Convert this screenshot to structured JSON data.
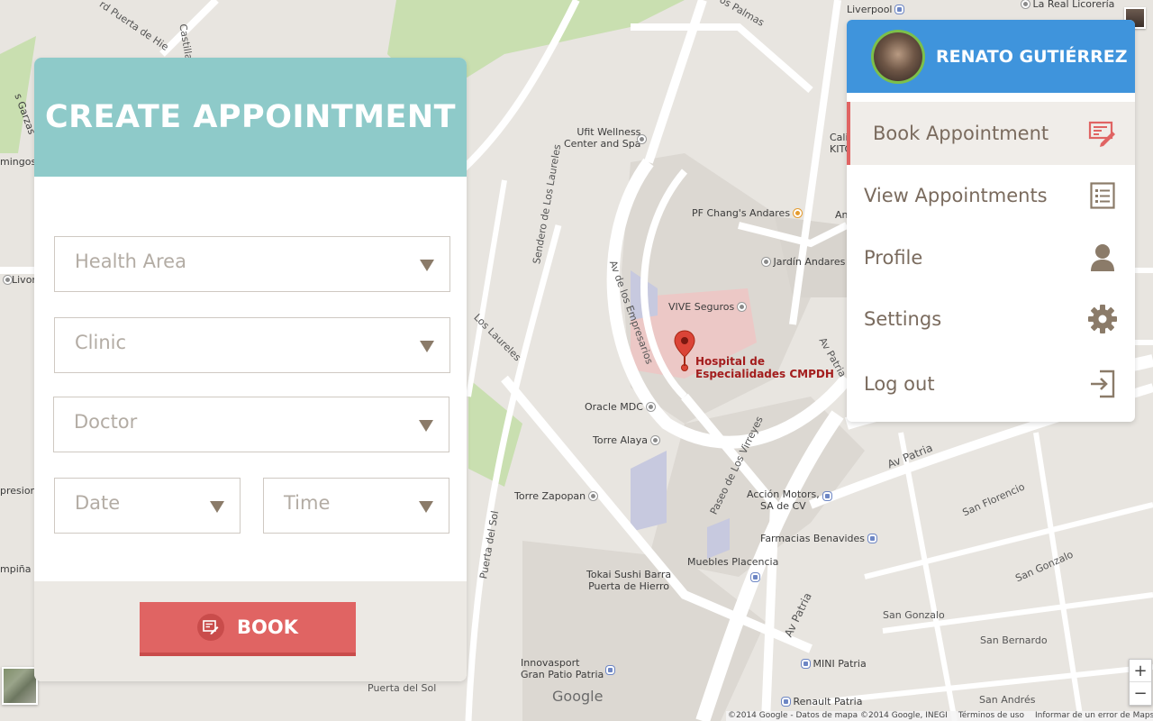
{
  "map": {
    "labels": {
      "liverpool": "Liverpool",
      "la_real_licoreria": "La Real Licorería",
      "ufit": "Ufit Wellness\nCenter and Spa",
      "pf_changs": "PF Chang's Andares",
      "jardin_andares": "Jardín Andares",
      "vive_seguros": "VIVE Seguros",
      "oracle": "Oracle MDC",
      "torre_alaya": "Torre Alaya",
      "torre_zapopan": "Torre Zapopan",
      "accion_motors": "Acción Motors,\nSA de CV",
      "farmacias": "Farmacias Benavides",
      "muebles": "Muebles Placencia",
      "tokai": "Tokai Sushi Barra\nPuerta de Hierro",
      "innovasport": "Innovasport\nGran Patio Patria",
      "mini_patria": "MINI Patria",
      "renault": "Renault Patria",
      "san_florencio": "San Florencio",
      "san_gonzalo": "San Gonzalo",
      "san_bernardo": "San Bernardo",
      "san_andres": "San Andrés",
      "av_patria": "Av Patria",
      "paseo_virreyes": "Paseo de Los Virreyes",
      "av_empresarios": "Av de los Empresarios",
      "sendero_laureles": "Sendero de Los Laureles",
      "los_laureles": "Los Laureles",
      "puerta_sol": "Puerta del Sol",
      "puerta_hierro": "rd Puerta de Hie",
      "castilla": "Castilla",
      "palmas": "os Palmas",
      "livorno": "Livorn",
      "presion": "presion",
      "pina": "mpiña",
      "mingos": "mingos",
      "garzas": "s Garzas",
      "cali": "Cali\nKITC",
      "an": "An",
      "av_patria_right": "Av Patria"
    },
    "hospital": "Hospital de\nEspecialidades CMPDH",
    "google": "Google",
    "credits": {
      "copyright": "©2014 Google - Datos de mapa ©2014 Google, INEGI",
      "terms": "Términos de uso",
      "report": "Informar de un error de Maps"
    },
    "zoom_in": "+",
    "zoom_out": "−"
  },
  "appointment": {
    "title": "CREATE APPOINTMENT",
    "fields": {
      "health_area": "Health Area",
      "clinic": "Clinic",
      "doctor": "Doctor",
      "date": "Date",
      "time": "Time"
    },
    "book_label": "BOOK"
  },
  "user_menu": {
    "user_name": "RENATO GUTIÉRREZ",
    "items": [
      {
        "label": "Book Appointment",
        "icon": "edit-form-icon",
        "active": true
      },
      {
        "label": "View Appointments",
        "icon": "list-icon",
        "active": false
      },
      {
        "label": "Profile",
        "icon": "person-icon",
        "active": false
      },
      {
        "label": "Settings",
        "icon": "gear-icon",
        "active": false
      },
      {
        "label": "Log out",
        "icon": "logout-icon",
        "active": false
      }
    ]
  },
  "colors": {
    "header_teal": "#8ecac9",
    "book_red": "#e06463",
    "user_blue": "#3f94dc",
    "menu_text": "#7a6b5e",
    "icon_brown": "#8b7b69"
  }
}
